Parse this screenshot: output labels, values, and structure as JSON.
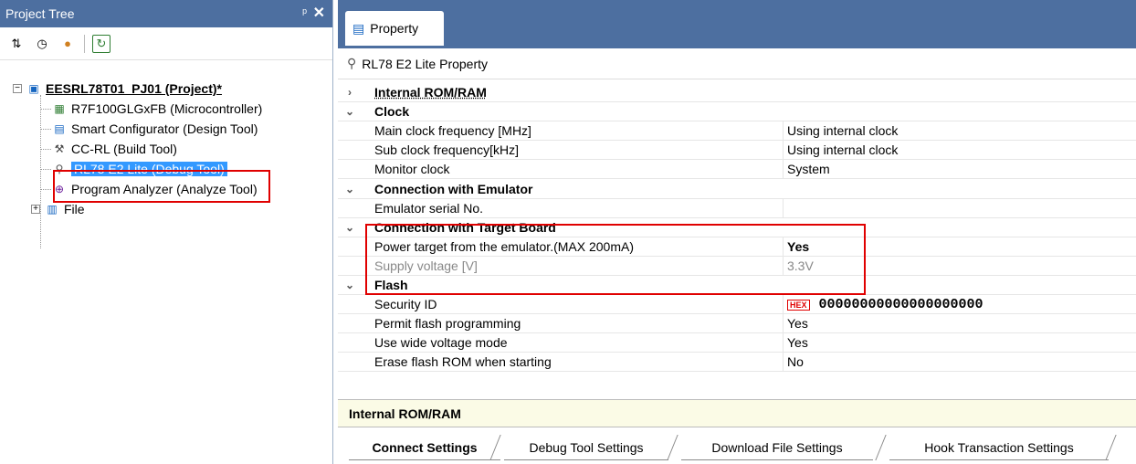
{
  "left_panel": {
    "title": "Project Tree",
    "pin_glyph": "ᵖ",
    "close_glyph": "✕",
    "toolbar": [
      {
        "name": "sort-icon",
        "glyph": "⇅"
      },
      {
        "name": "clock-icon",
        "glyph": "◷"
      },
      {
        "name": "user-icon",
        "glyph": "●"
      },
      {
        "name": "refresh-icon",
        "glyph": "↻"
      }
    ],
    "tree": {
      "project": "EESRL78T01_PJ01 (Project)*",
      "items": [
        {
          "label": "R7F100GLGxFB (Microcontroller)",
          "icon": "chip-icon",
          "glyph": "▦",
          "color": "#2e7d32"
        },
        {
          "label": "Smart Configurator (Design Tool)",
          "icon": "configurator-icon",
          "glyph": "▤",
          "color": "#1565c0"
        },
        {
          "label": "CC-RL (Build Tool)",
          "icon": "build-tool-icon",
          "glyph": "⚒",
          "color": "#444444"
        },
        {
          "label": "RL78 E2 Lite (Debug Tool)",
          "icon": "debug-tool-icon",
          "glyph": "⚲",
          "color": "#555555"
        },
        {
          "label": "Program Analyzer (Analyze Tool)",
          "icon": "analyzer-icon",
          "glyph": "⊕",
          "color": "#6a1b9a"
        }
      ],
      "file_folder": "File"
    }
  },
  "right_panel": {
    "tab_label": "Property",
    "header": "RL78 E2 Lite Property",
    "rows": [
      {
        "type": "cat",
        "expander": "›",
        "name": "Internal ROM/RAM"
      },
      {
        "type": "cat",
        "expander": "⌄",
        "name": "Clock"
      },
      {
        "type": "prop",
        "name": "Main clock frequency [MHz]",
        "value": "Using internal clock"
      },
      {
        "type": "prop",
        "name": "Sub clock frequency[kHz]",
        "value": "Using internal clock"
      },
      {
        "type": "prop",
        "name": "Monitor clock",
        "value": "System"
      },
      {
        "type": "cat",
        "expander": "⌄",
        "name": "Connection with Emulator"
      },
      {
        "type": "prop",
        "name": "Emulator serial No.",
        "value": ""
      },
      {
        "type": "cat",
        "expander": "⌄",
        "name": "Connection with Target Board"
      },
      {
        "type": "prop",
        "name": "Power target from the emulator.(MAX 200mA)",
        "value": "Yes",
        "style": "bold"
      },
      {
        "type": "prop",
        "name": "Supply voltage [V]",
        "value": "3.3V",
        "style": "gray"
      },
      {
        "type": "cat",
        "expander": "⌄",
        "name": "Flash"
      },
      {
        "type": "prop",
        "name": "Security ID",
        "value": "00000000000000000000",
        "style": "hex"
      },
      {
        "type": "prop",
        "name": "Permit flash programming",
        "value": "Yes"
      },
      {
        "type": "prop",
        "name": "Use wide voltage mode",
        "value": "Yes"
      },
      {
        "type": "prop",
        "name": "Erase flash ROM when starting",
        "value": "No"
      }
    ],
    "hex_badge": "HEX",
    "description": "Internal ROM/RAM",
    "bottom_tabs": [
      "Connect Settings",
      "Debug Tool Settings",
      "Download File Settings",
      "Hook Transaction Settings"
    ]
  },
  "colors": {
    "title_bar": "#4d6fa0",
    "selection": "#3399ff",
    "highlight_box": "#e00000",
    "description_bg": "#fbfbe6"
  }
}
